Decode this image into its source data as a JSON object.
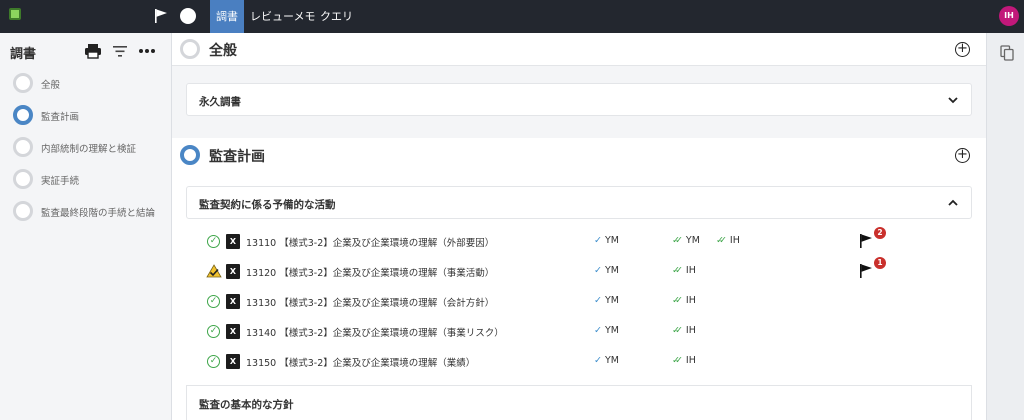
{
  "topbar": {
    "tabs": [
      {
        "label": "調書",
        "active": true
      },
      {
        "label": "レビューメモ",
        "active": false
      },
      {
        "label": "クエリ",
        "active": false
      }
    ],
    "info_glyph": "i",
    "user_initials": "IH",
    "avatar_color": "#c2187a",
    "icons": [
      "app-logo-icon",
      "flag-icon",
      "info-icon"
    ]
  },
  "sidebar": {
    "title": "調書",
    "tools": [
      "print-icon",
      "filter-icon",
      "more-icon"
    ],
    "items": [
      {
        "label": "全般",
        "active": false
      },
      {
        "label": "監査計画",
        "active": true
      },
      {
        "label": "内部統制の理解と検証",
        "active": false
      },
      {
        "label": "実証手続",
        "active": false
      },
      {
        "label": "監査最終段階の手続と結論",
        "active": false
      }
    ]
  },
  "main": {
    "sections": [
      {
        "title": "全般",
        "cards": [
          {
            "title": "永久調書",
            "expanded": false
          }
        ]
      },
      {
        "title": "監査計画",
        "cards": [
          {
            "title": "監査契約に係る予備的な活動",
            "expanded": true,
            "rows": [
              {
                "status": "complete",
                "file_glyph": "X",
                "label": "13110 【様式3-2】企業及び企業環境の理解（外部要因）",
                "preparer": "YM",
                "reviewer1": "YM",
                "reviewer2": "IH",
                "flag_count": "2"
              },
              {
                "status": "warning",
                "file_glyph": "X",
                "label": "13120 【様式3-2】企業及び企業環境の理解（事業活動）",
                "preparer": "YM",
                "reviewer1": "IH",
                "reviewer2": "",
                "flag_count": "1"
              },
              {
                "status": "complete",
                "file_glyph": "X",
                "label": "13130 【様式3-2】企業及び企業環境の理解（会計方針）",
                "preparer": "YM",
                "reviewer1": "IH",
                "reviewer2": "",
                "flag_count": ""
              },
              {
                "status": "complete",
                "file_glyph": "X",
                "label": "13140 【様式3-2】企業及び企業環境の理解（事業リスク）",
                "preparer": "YM",
                "reviewer1": "IH",
                "reviewer2": "",
                "flag_count": ""
              },
              {
                "status": "complete",
                "file_glyph": "X",
                "label": "13150 【様式3-2】企業及び企業環境の理解（業績）",
                "preparer": "YM",
                "reviewer1": "IH",
                "reviewer2": "",
                "flag_count": ""
              }
            ]
          },
          {
            "title": "監査の基本的な方針",
            "expanded": false
          }
        ]
      }
    ]
  },
  "glyphs": {
    "plus": "+",
    "check_ok": "✓",
    "check_single": "✓",
    "check_double": "✓✓"
  },
  "colors": {
    "accent": "#4a7fc1",
    "ring_active": "#4a86c5",
    "ok_green": "#3fa64a",
    "badge_red": "#c9302c",
    "topbar": "#23272f"
  }
}
